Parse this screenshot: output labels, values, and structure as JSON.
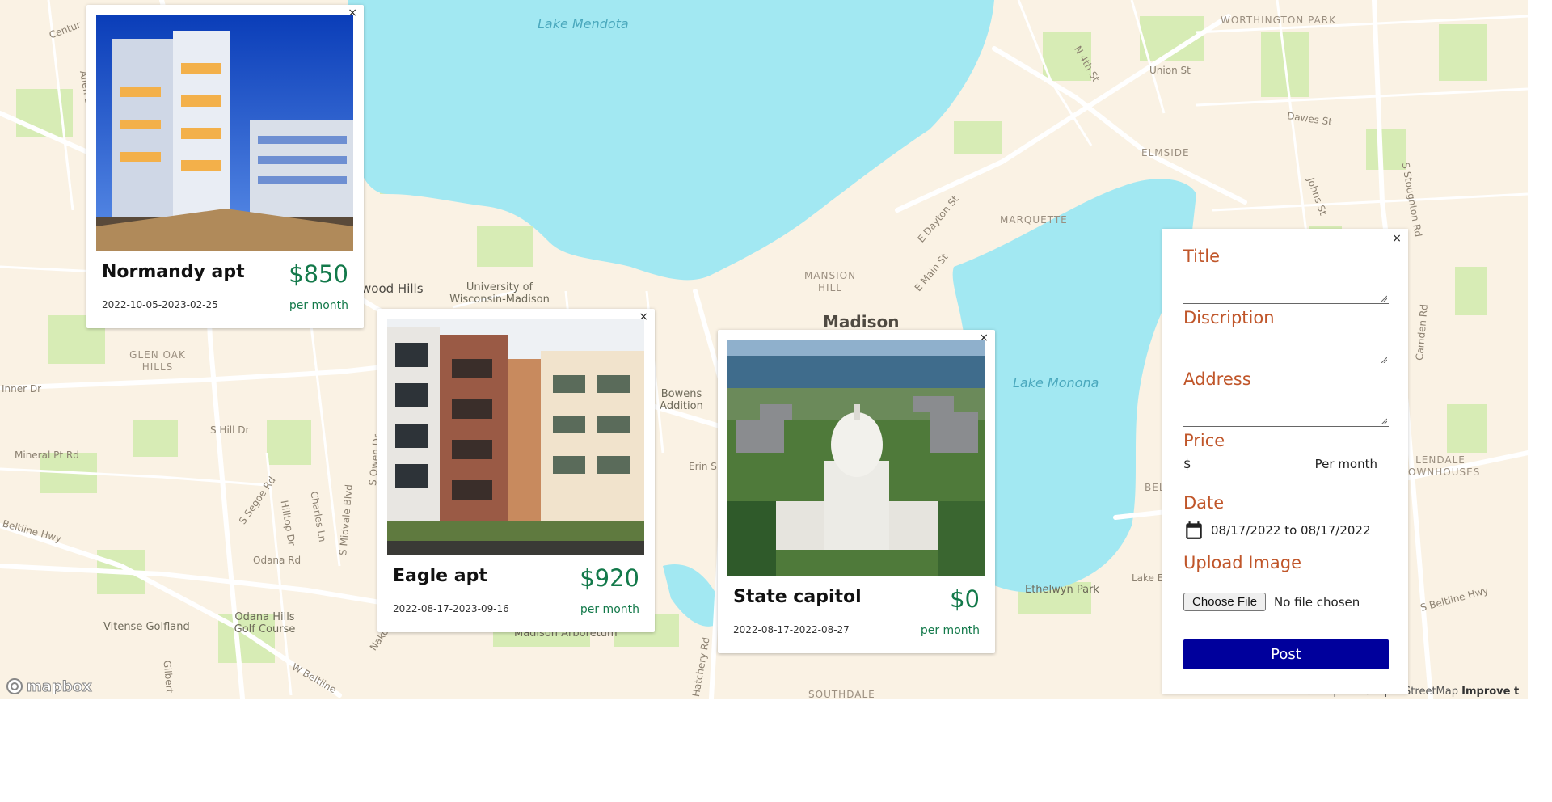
{
  "map": {
    "water_labels": [
      "Lake Mendota",
      "Lake Monona"
    ],
    "neighborhoods": [
      "WORTHINGTON PARK",
      "ELMSIDE",
      "MARQUETTE",
      "MANSION HILL",
      "GLEN OAK HILLS",
      "SOUTHDALE",
      "LENDALE OWNHOUSES"
    ],
    "city_label": "Madison",
    "places": [
      "University of Wisconsin-Madison",
      "wood Hills",
      "Bowens Addition",
      "Madison Arboretum",
      "Odana Hills Golf Course",
      "Vitense Golfland",
      "Ethelwyn Park",
      "BELL",
      "Lake E"
    ],
    "streets": [
      "Allen Blvd",
      "Centur",
      "Union St",
      "N 4th St",
      "Dawes St",
      "Johns St",
      "S Stoughton Rd",
      "E Dayton St",
      "E Main St",
      "Inner Dr",
      "Mineral Pt Rd",
      "S Hill Dr",
      "S Owen Dr",
      "S Segoe Rd",
      "Hilltop Dr",
      "Charles Ln",
      "S Midvale Blvd",
      "Odana Rd",
      "Beltline Hwy",
      "W Beltline",
      "Erin S",
      "S Beltline Hwy",
      "Camden Rd",
      "Gilbert",
      "Hatchery Rd",
      "Nako"
    ],
    "attribution": "© Mapbox © OpenStreetMap",
    "improve": "Improve t",
    "logo": "mapbox"
  },
  "cards": [
    {
      "title": "Normandy apt",
      "price": "$850",
      "dates": "2022-10-05-2023-02-25",
      "per": "per month",
      "close": "×"
    },
    {
      "title": "Eagle apt",
      "price": "$920",
      "dates": "2022-08-17-2023-09-16",
      "per": "per month",
      "close": "×"
    },
    {
      "title": "State capitol",
      "price": "$0",
      "dates": "2022-08-17-2022-08-27",
      "per": "per month",
      "close": "×"
    }
  ],
  "form": {
    "close": "×",
    "title_label": "Title",
    "description_label": "Discription",
    "address_label": "Address",
    "price_label": "Price",
    "price_prefix": "$",
    "price_suffix": "Per month",
    "date_label": "Date",
    "date_value": "08/17/2022 to 08/17/2022",
    "upload_label": "Upload Image",
    "file_button": "Choose File",
    "file_status": "No file chosen",
    "post_button": "Post"
  },
  "colors": {
    "price_green": "#13794a",
    "label_orange": "#c0562a",
    "post_blue": "#00009c",
    "water": "#a2e8f2",
    "land": "#faf2e4",
    "park": "#d7ecb5"
  }
}
